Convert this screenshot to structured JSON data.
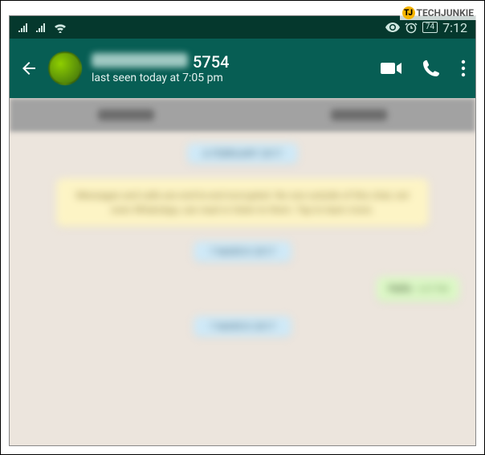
{
  "watermark": {
    "logo": "TJ",
    "text": "TECHJUNKIE"
  },
  "status_bar": {
    "battery": "74",
    "clock": "7:12"
  },
  "chat_header": {
    "contact_suffix": "5754",
    "last_seen": "last seen today at 7:05 pm"
  },
  "chat": {
    "date1": "A FEBRUARY 2017",
    "encryption_notice": "Messages and calls are end-to-end encrypted. No one outside of this chat, not even WhatsApp, can read or listen to them. Tap to learn more.",
    "date2": "7 MARCH 2017",
    "out1": {
      "text": "Hello",
      "time": "6:57 PM"
    },
    "date3": "7 MARCH 2017"
  }
}
